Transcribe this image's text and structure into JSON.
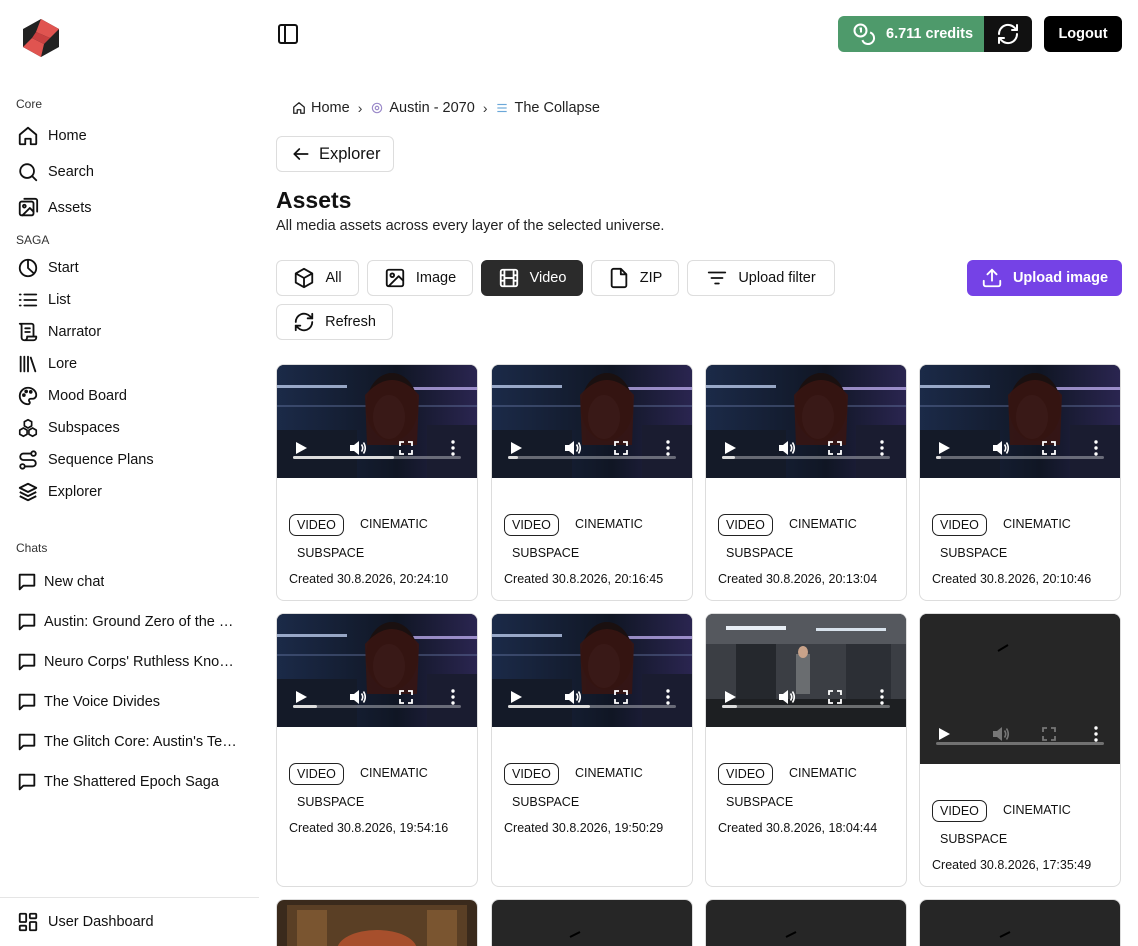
{
  "sidebar": {
    "core_label": "Core",
    "core_items": [
      {
        "label": "Home",
        "icon": "home-icon"
      },
      {
        "label": "Search",
        "icon": "search-icon"
      },
      {
        "label": "Assets",
        "icon": "image-icon"
      }
    ],
    "saga_label": "SAGA",
    "saga_items": [
      {
        "label": "Start",
        "icon": "pie-icon"
      },
      {
        "label": "List",
        "icon": "list-icon"
      },
      {
        "label": "Narrator",
        "icon": "scroll-icon"
      },
      {
        "label": "Lore",
        "icon": "library-icon"
      },
      {
        "label": "Mood Board",
        "icon": "palette-icon"
      },
      {
        "label": "Subspaces",
        "icon": "boxes-icon"
      },
      {
        "label": "Sequence Plans",
        "icon": "route-icon"
      },
      {
        "label": "Explorer",
        "icon": "layers-icon"
      }
    ],
    "chats_label": "Chats",
    "chats": [
      "New chat",
      "Austin: Ground Zero of the Neuro Uprising",
      "Neuro Corps' Ruthless Knowledge Purge",
      "The Voice Divides",
      "The Glitch Core: Austin's Terminal Descent",
      "The Shattered Epoch Saga"
    ],
    "footer_label": "User Dashboard"
  },
  "header": {
    "credits": "6.711 credits",
    "logout": "Logout"
  },
  "breadcrumb": {
    "home": "Home",
    "universe": "Austin - 2070",
    "layer": "The Collapse",
    "separator": "›"
  },
  "explorer_button": "Explorer",
  "page": {
    "title": "Assets",
    "subtitle": "All media assets across every layer of the selected universe."
  },
  "filters": {
    "all": "All",
    "image": "Image",
    "video": "Video",
    "zip": "ZIP",
    "upload_filter": "Upload filter",
    "refresh": "Refresh",
    "upload_image": "Upload image"
  },
  "colors": {
    "credits_green": "#4e9a6b",
    "upload_purple": "#7542e6",
    "active_filter": "#2b2b2b"
  },
  "assets": [
    {
      "type_tag": "VIDEO",
      "tag2": "CINEMATIC",
      "tag3": "SUBSPACE",
      "created": "Created 30.8.2026, 20:24:10",
      "progress": 0.6
    },
    {
      "type_tag": "VIDEO",
      "tag2": "CINEMATIC",
      "tag3": "SUBSPACE",
      "created": "Created 30.8.2026, 20:16:45",
      "progress": 0.06
    },
    {
      "type_tag": "VIDEO",
      "tag2": "CINEMATIC",
      "tag3": "SUBSPACE",
      "created": "Created 30.8.2026, 20:13:04",
      "progress": 0.08
    },
    {
      "type_tag": "VIDEO",
      "tag2": "CINEMATIC",
      "tag3": "SUBSPACE",
      "created": "Created 30.8.2026, 20:10:46",
      "progress": 0.03
    },
    {
      "type_tag": "VIDEO",
      "tag2": "CINEMATIC",
      "tag3": "SUBSPACE",
      "created": "Created 30.8.2026, 19:54:16",
      "progress": 0.14
    },
    {
      "type_tag": "VIDEO",
      "tag2": "CINEMATIC",
      "tag3": "SUBSPACE",
      "created": "Created 30.8.2026, 19:50:29",
      "progress": 0.49
    },
    {
      "type_tag": "VIDEO",
      "tag2": "CINEMATIC",
      "tag3": "SUBSPACE",
      "created": "Created 30.8.2026, 18:04:44",
      "progress": 0.09
    },
    {
      "type_tag": "VIDEO",
      "tag2": "CINEMATIC",
      "tag3": "SUBSPACE",
      "created": "Created 30.8.2026, 17:35:49",
      "progress": 0
    }
  ]
}
